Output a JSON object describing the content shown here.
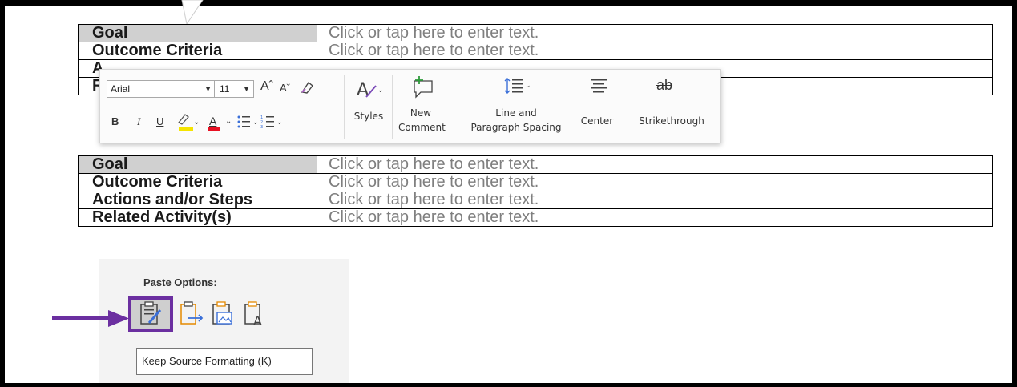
{
  "table1": {
    "rows": [
      {
        "label": "Goal",
        "value": "Click or tap here to enter text."
      },
      {
        "label": "Outcome Criteria",
        "value": "Click or tap here to enter text."
      },
      {
        "label": "A",
        "value": ""
      },
      {
        "label": "R",
        "value": ""
      }
    ]
  },
  "table2": {
    "rows": [
      {
        "label": "Goal",
        "value": "Click or tap here to enter text."
      },
      {
        "label": "Outcome Criteria",
        "value": "Click or tap here to enter text."
      },
      {
        "label": "Actions and/or Steps",
        "value": "Click or tap here to enter text."
      },
      {
        "label": "Related Activity(s)",
        "value": "Click or tap here to enter text."
      }
    ]
  },
  "mini_toolbar": {
    "font_name": "Arial",
    "font_size": "11",
    "styles_label": "Styles",
    "new_comment_label": "New Comment",
    "new_comment_line1": "New",
    "new_comment_line2": "Comment",
    "line_spacing_line1": "Line and",
    "line_spacing_line2": "Paragraph Spacing",
    "center_label": "Center",
    "strikethrough_label": "Strikethrough",
    "bold": "B",
    "italic": "I",
    "underline": "U",
    "strike_glyph": "ab",
    "grow_font": "Aˆ",
    "shrink_font": "Aˇ",
    "highlight_color": "#f5e400",
    "font_color": "#e81123"
  },
  "paste_options": {
    "title": "Paste Options:",
    "tooltip": "Keep Source Formatting (K)",
    "selected_color": "#6b2fa0"
  },
  "arrow_color": "#6b2fa0"
}
